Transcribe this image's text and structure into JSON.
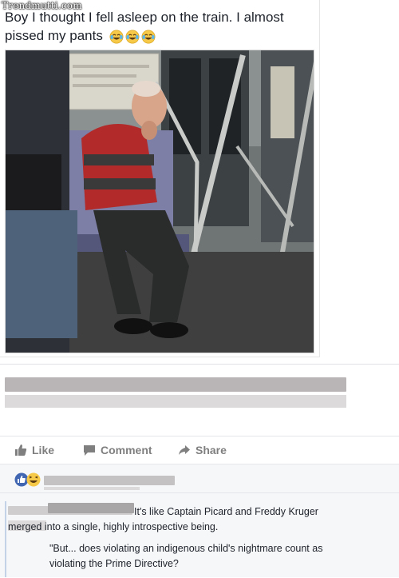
{
  "watermark": "Trendmutti.com",
  "post": {
    "text": "Boy I thought I fell asleep on the train. I almost pissed my pants",
    "emojis": [
      "laughing-tears-emoji",
      "laughing-tears-emoji",
      "laughing-tears-emoji"
    ]
  },
  "actions": {
    "like_label": "Like",
    "comment_label": "Comment",
    "share_label": "Share"
  },
  "reactions": [
    "like-reaction-icon",
    "haha-reaction-icon"
  ],
  "comment": {
    "line1": "It's like Captain Picard and Freddy Kruger merged into a single, highly introspective being.",
    "line2": "\"But... does violating an indigenous child's nightmare count as violating the Prime Directive?"
  },
  "colors": {
    "text": "#1d2129",
    "action_gray": "#7f7f7f",
    "like_blue": "#4267b2",
    "haha_yellow": "#f7c948",
    "panel_bg": "#f6f7f9"
  }
}
